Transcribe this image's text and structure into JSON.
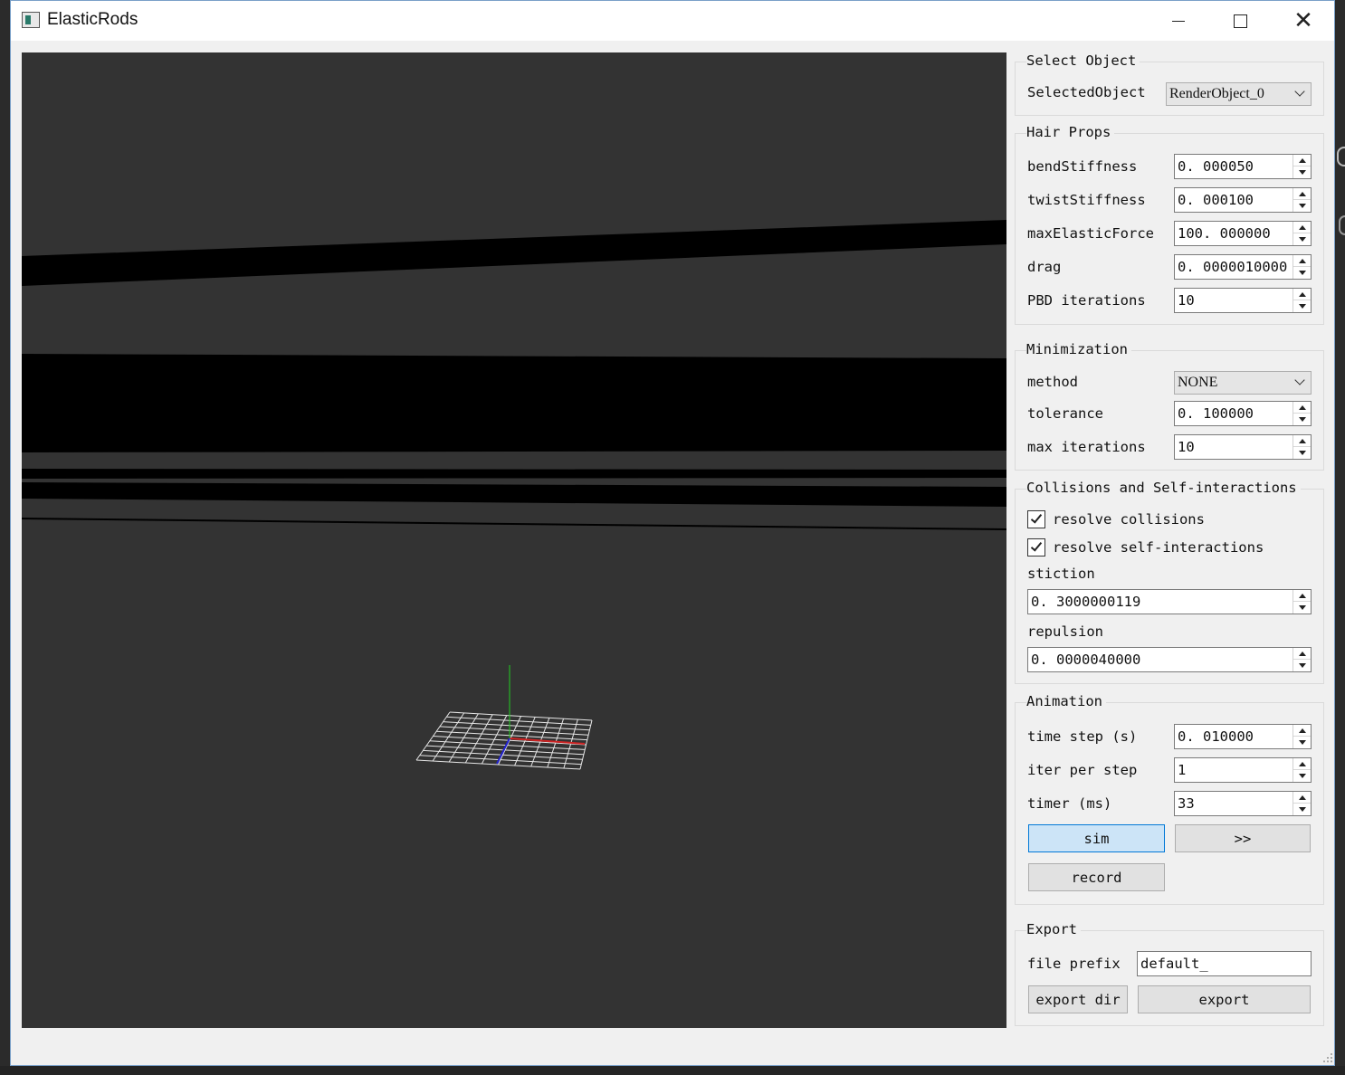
{
  "window": {
    "title": "ElasticRods"
  },
  "colors": {
    "viewport_bg": "#333333",
    "rod": "#000000",
    "grid": "#e6e6e6",
    "axis_x": "#cc2222",
    "axis_y": "#22cc22",
    "axis_z": "#2222cc",
    "active_button": "#cce4f7",
    "accent": "#0078d7"
  },
  "icons": {
    "app": "app-window-icon",
    "minimize": "minimize-icon",
    "maximize": "maximize-icon",
    "close": "close-icon"
  },
  "select_object": {
    "title": "Select Object",
    "label": "SelectedObject",
    "value": "RenderObject_0"
  },
  "hair_props": {
    "title": "Hair Props",
    "fields": [
      {
        "label": "bendStiffness",
        "value": "0. 000050"
      },
      {
        "label": "twistStiffness",
        "value": "0. 000100"
      },
      {
        "label": "maxElasticForce",
        "value": "100. 000000"
      },
      {
        "label": "drag",
        "value": "0. 0000010000"
      },
      {
        "label": "PBD iterations",
        "value": "10"
      }
    ]
  },
  "minimization": {
    "title": "Minimization",
    "method_label": "method",
    "method_value": "NONE",
    "tolerance_label": "tolerance",
    "tolerance_value": "0. 100000",
    "max_iter_label": "max iterations",
    "max_iter_value": "10"
  },
  "collisions": {
    "title": "Collisions and Self-interactions",
    "resolve_collisions_label": "resolve collisions",
    "resolve_collisions_checked": true,
    "resolve_self_label": "resolve self-interactions",
    "resolve_self_checked": true,
    "stiction_label": "stiction",
    "stiction_value": "0. 3000000119",
    "repulsion_label": "repulsion",
    "repulsion_value": "0. 0000040000"
  },
  "animation": {
    "title": "Animation",
    "time_step_label": "time step (s)",
    "time_step_value": "0. 010000",
    "iter_per_step_label": "iter per step",
    "iter_per_step_value": "1",
    "timer_label": "timer (ms)",
    "timer_value": "33",
    "sim_label": "sim",
    "step_label": ">>",
    "record_label": "record"
  },
  "export": {
    "title": "Export",
    "prefix_label": "file prefix",
    "prefix_value": "default_",
    "export_dir_label": "export dir",
    "export_label": "export"
  }
}
